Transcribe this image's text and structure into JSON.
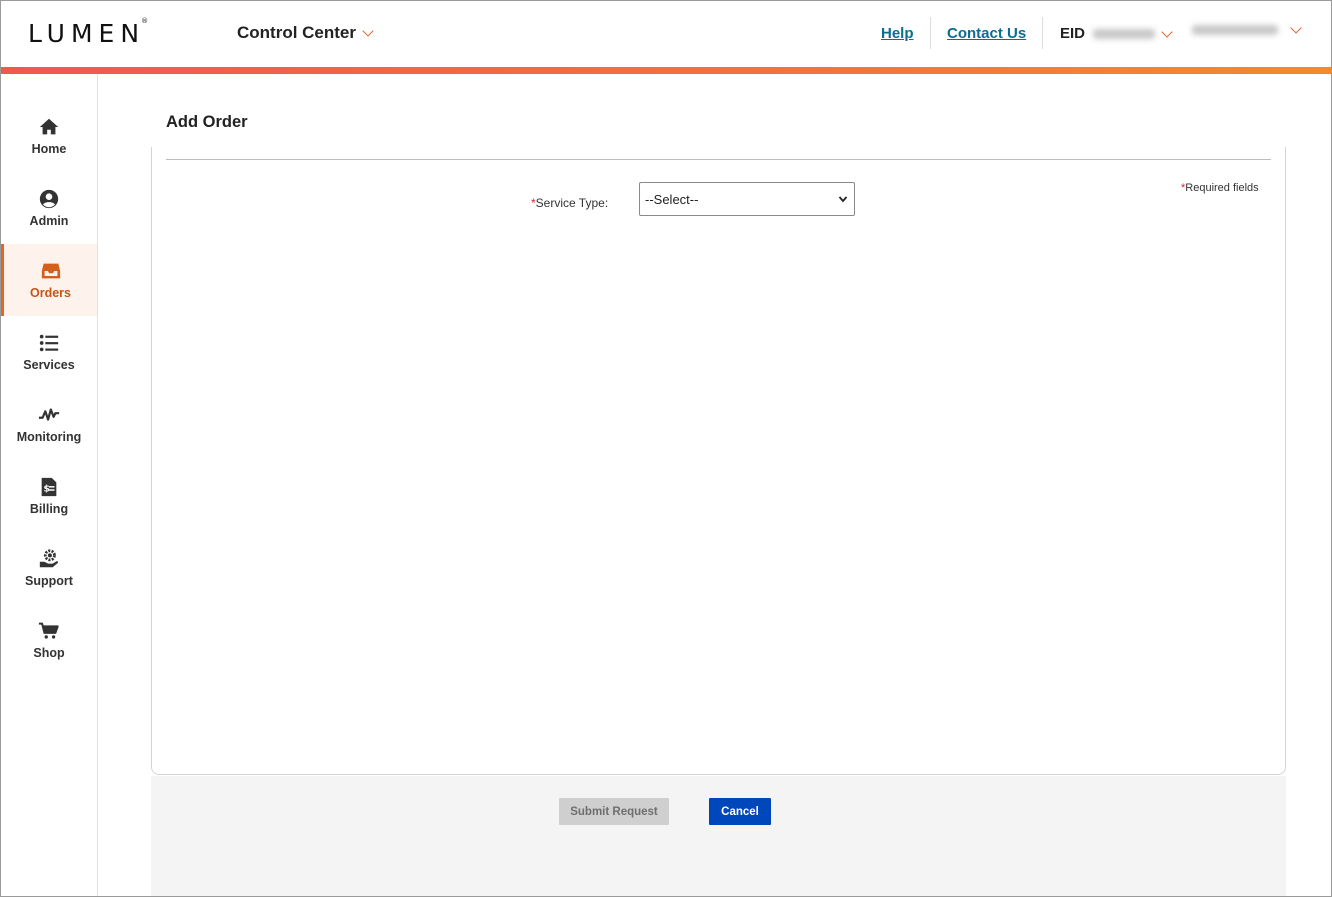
{
  "header": {
    "logo_text": "LUMEN",
    "logo_mark": "®",
    "app_name": "Control Center",
    "help_link": "Help",
    "contact_link": "Contact Us",
    "eid_label": "EID",
    "accent_color": "#e0662a",
    "link_color": "#0a6e8c"
  },
  "sidebar": {
    "items": [
      {
        "label": "Home",
        "icon": "home-icon"
      },
      {
        "label": "Admin",
        "icon": "user-circle-icon"
      },
      {
        "label": "Orders",
        "icon": "inbox-icon",
        "active": true
      },
      {
        "label": "Services",
        "icon": "list-icon"
      },
      {
        "label": "Monitoring",
        "icon": "pulse-icon"
      },
      {
        "label": "Billing",
        "icon": "invoice-icon"
      },
      {
        "label": "Support",
        "icon": "support-gear-icon"
      },
      {
        "label": "Shop",
        "icon": "cart-icon"
      }
    ]
  },
  "main": {
    "title": "Add Order",
    "required_note": "Required fields",
    "required_marker": "*",
    "service_type": {
      "label": "Service Type:",
      "selected": "--Select--"
    }
  },
  "actions": {
    "submit_label": "Submit Request",
    "cancel_label": "Cancel",
    "cancel_color": "#0047bb"
  }
}
